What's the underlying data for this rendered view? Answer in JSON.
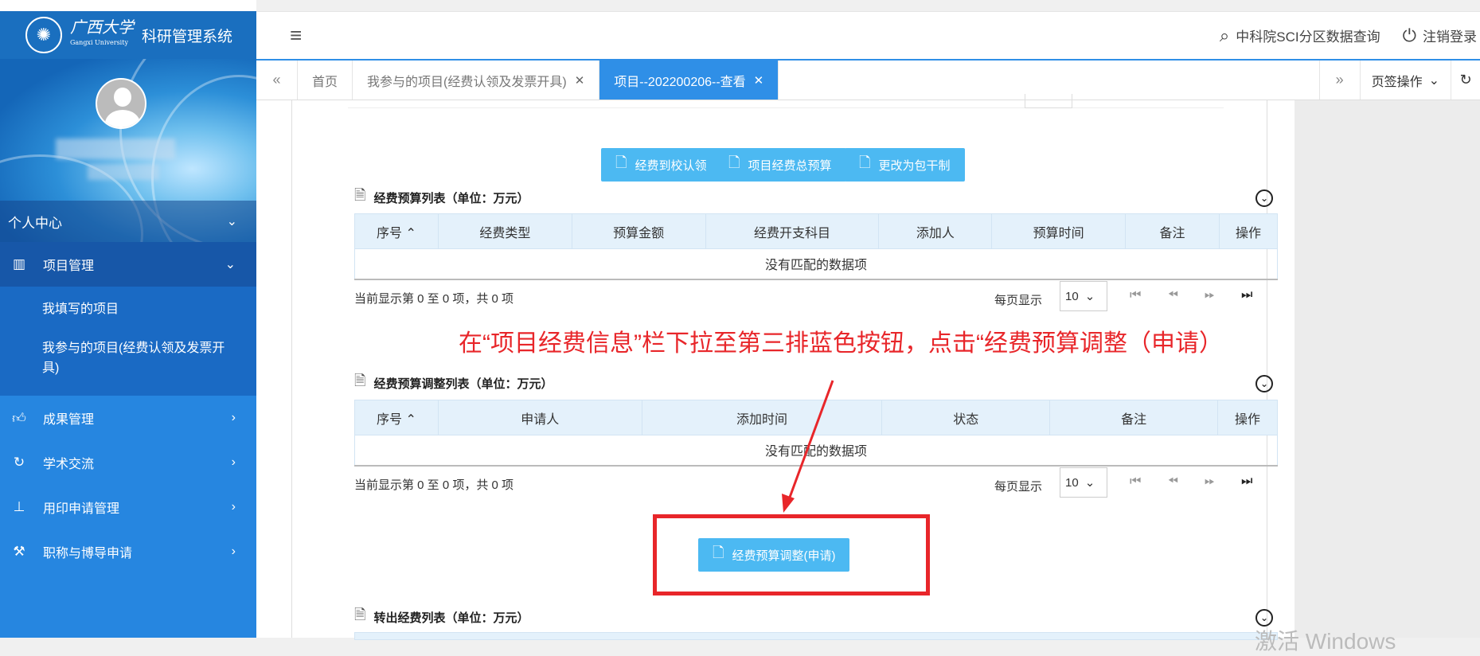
{
  "logo": {
    "cal": "广西大学",
    "en": "Gangxi University",
    "system": "科研管理系统"
  },
  "topbar": {
    "sci_query": "中科院SCI分区数据查询",
    "logout": "注销登录"
  },
  "sidebar": {
    "personal_center": "个人中心",
    "items": [
      {
        "label": "项目管理",
        "icon": "grid-icon"
      },
      {
        "label": "成果管理",
        "icon": "thumbs-up-icon"
      },
      {
        "label": "学术交流",
        "icon": "refresh-icon"
      },
      {
        "label": "用印申请管理",
        "icon": "stamp-icon"
      },
      {
        "label": "职称与博导申请",
        "icon": "hammer-icon"
      }
    ],
    "sub_items": [
      "我填写的项目",
      "我参与的项目(经费认领及发票开具)"
    ]
  },
  "tabs": {
    "items": [
      "首页",
      "我参与的项目(经费认领及发票开具)",
      "项目--202200206--查看"
    ],
    "ops": "页签操作"
  },
  "buttons": {
    "claim": "经费到校认领",
    "total_budget": "项目经费总预算",
    "lump_sum": "更改为包干制",
    "adjust_apply": "经费预算调整(申请)"
  },
  "budget_list": {
    "title": "经费预算列表（单位：万元）",
    "headers": [
      "序号",
      "经费类型",
      "预算金额",
      "经费开支科目",
      "添加人",
      "预算时间",
      "备注",
      "操作"
    ],
    "empty": "没有匹配的数据项"
  },
  "adjust_list": {
    "title": "经费预算调整列表（单位：万元）",
    "headers": [
      "序号",
      "申请人",
      "添加时间",
      "状态",
      "备注",
      "操作"
    ],
    "empty": "没有匹配的数据项"
  },
  "transfer_list": {
    "title": "转出经费列表（单位：万元）"
  },
  "pagination": {
    "info": "当前显示第 0 至 0 项，共 0 项",
    "per_page_label": "每页显示",
    "per_page_value": "10"
  },
  "annotation": "在“项目经费信息”栏下拉至第三排蓝色按钮，点击“经费预算调整（申请）",
  "watermark": "激活 Windows",
  "colors": {
    "primary": "#2686e0",
    "button": "#4cb9f2",
    "annotation": "#e8262a"
  }
}
